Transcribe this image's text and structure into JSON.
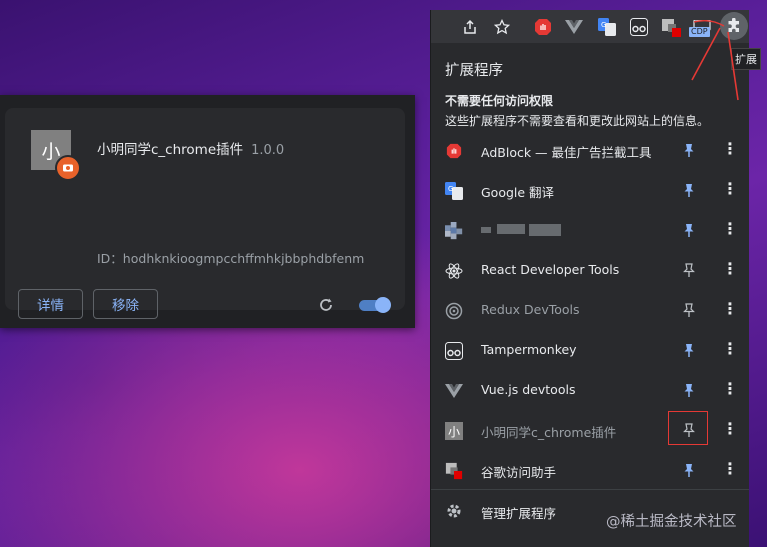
{
  "card": {
    "icon_char": "小",
    "name": "小明同学c_chrome插件",
    "version": "1.0.0",
    "id_text": "ID：hodhknkioogmpcchffmhkjbbphdbfenm",
    "details_label": "详情",
    "remove_label": "移除",
    "enabled": true
  },
  "toolbar": {
    "cdp_label": "CDP",
    "tooltip": "扩展"
  },
  "popup": {
    "title": "扩展程序",
    "section_title": "不需要任何访问权限",
    "section_desc": "这些扩展程序不需要查看和更改此网站上的信息。",
    "items": [
      {
        "name": "AdBlock — 最佳广告拦截工具",
        "pinned": true,
        "icon": "adblock-icon"
      },
      {
        "name": "Google 翻译",
        "pinned": true,
        "icon": "google-translate-icon"
      },
      {
        "name": "",
        "pinned": true,
        "icon": "blurred-icon"
      },
      {
        "name": "React Developer Tools",
        "pinned": false,
        "icon": "react-icon"
      },
      {
        "name": "Redux DevTools",
        "pinned": false,
        "icon": "redux-icon"
      },
      {
        "name": "Tampermonkey",
        "pinned": true,
        "icon": "tampermonkey-icon"
      },
      {
        "name": "Vue.js devtools",
        "pinned": true,
        "icon": "vue-icon"
      },
      {
        "name": "小明同学c_chrome插件",
        "pinned": false,
        "icon": "xiaoming-icon"
      },
      {
        "name": "谷歌访问助手",
        "pinned": true,
        "icon": "google-helper-icon"
      }
    ],
    "manage_label": "管理扩展程序"
  },
  "watermark": "@稀土掘金技术社区",
  "colors": {
    "accent": "#8ab4f8",
    "panel": "#292a2d",
    "highlight": "#e53935"
  }
}
